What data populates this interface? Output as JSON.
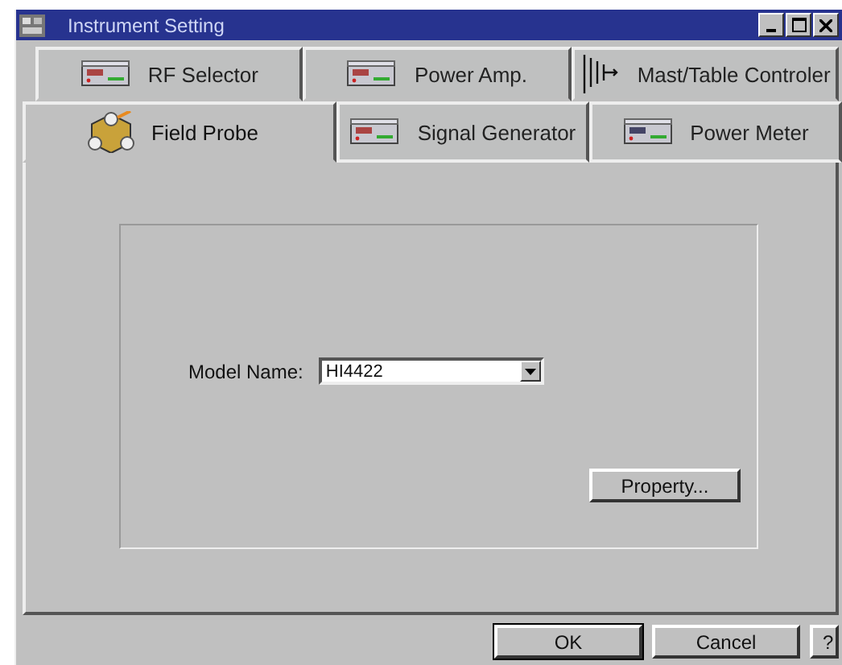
{
  "window": {
    "title": "Instrument Setting"
  },
  "tab_rows": [
    [
      {
        "label": "RF Selector",
        "selected": false
      },
      {
        "label": "Power Amp.",
        "selected": false
      },
      {
        "label": "Mast/Table Controler",
        "selected": false
      }
    ],
    [
      {
        "label": "Field Probe",
        "selected": true
      },
      {
        "label": "Signal Generator",
        "selected": false
      },
      {
        "label": "Power Meter",
        "selected": false
      }
    ]
  ],
  "model": {
    "label": "Model Name:",
    "value": "HI4422"
  },
  "property_button": "Property...",
  "buttons": [
    {
      "label": "OK",
      "default": true
    },
    {
      "label": "Cancel",
      "default": false
    },
    {
      "label": "?",
      "default": false
    }
  ]
}
